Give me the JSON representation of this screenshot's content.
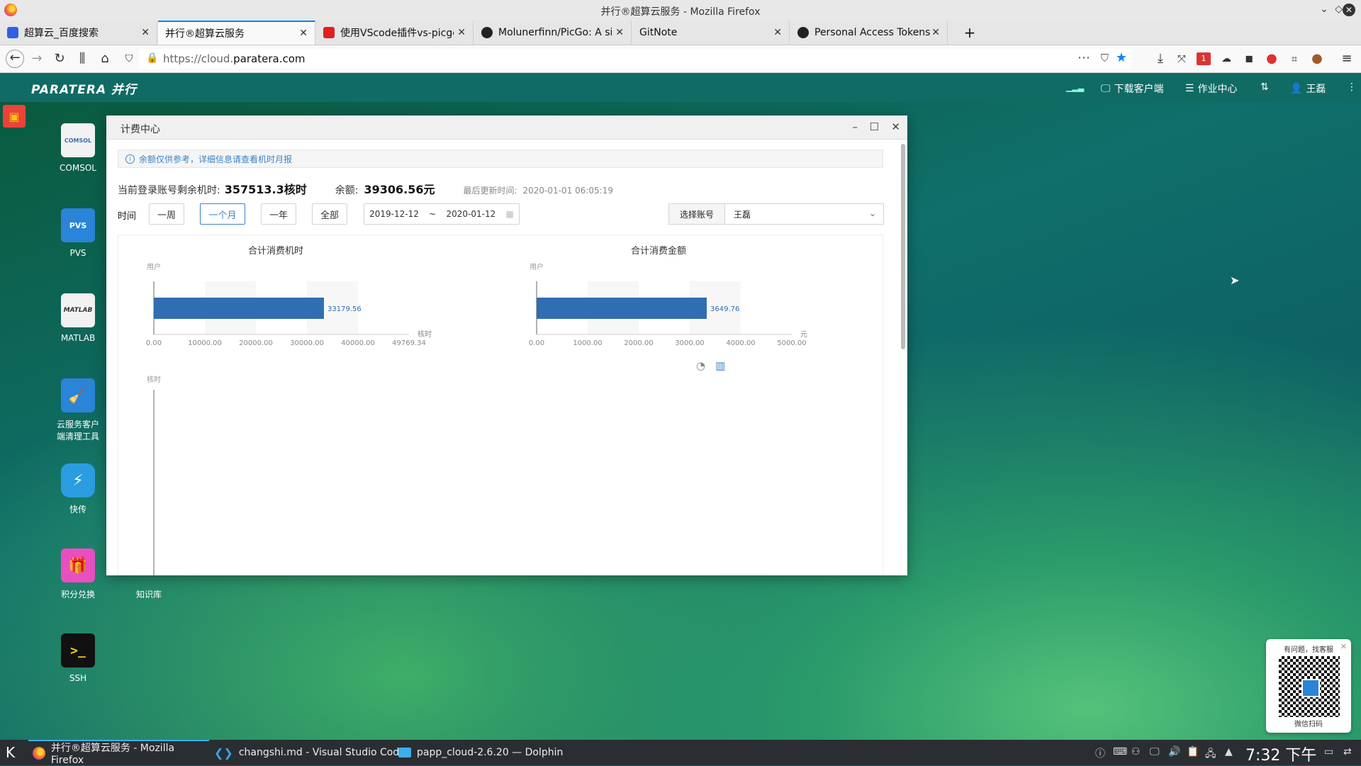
{
  "window": {
    "title": "并行®超算云服务 - Mozilla Firefox"
  },
  "tabs": [
    {
      "label": "超算云_百度搜索",
      "favicon_color": "#3060e0"
    },
    {
      "label": "并行®超算云服务",
      "favicon_color": "#ffffff"
    },
    {
      "label": "使用VScode插件vs-picgo作",
      "favicon_color": "#e02020"
    },
    {
      "label": "Molunerfinn/PicGo: A simp",
      "favicon_color": "#222222"
    },
    {
      "label": "GitNote",
      "favicon_color": "#ffffff"
    },
    {
      "label": "Personal Access Tokens",
      "favicon_color": "#222222"
    }
  ],
  "new_tab": "+",
  "nav": {
    "url_prefix": "https://cloud.",
    "url_domain": "paratera.com",
    "badge": "1"
  },
  "app_header": {
    "logo": "PARATERA 并行",
    "download": "下载客户端",
    "jobs": "作业中心",
    "user": "王磊"
  },
  "desktop_icons": [
    {
      "label": "COMSOL",
      "glyph": "COMSOL",
      "color": "#f2f2f2"
    },
    {
      "label": "PVS",
      "glyph": "PVS",
      "color": "#2a84d8"
    },
    {
      "label": "MATLAB",
      "glyph": "MATLAB",
      "color": "#f2f2f2"
    },
    {
      "label": "云服务客户端清理工具",
      "glyph": "🧹",
      "color": "#2a84d8"
    },
    {
      "label": "快传",
      "glyph": "⚡",
      "color": "#2a9de0"
    },
    {
      "label": "积分兑换",
      "glyph": "🎁",
      "color": "#e84fc0"
    },
    {
      "label": "SSH",
      "glyph": ">_",
      "color": "#111111"
    },
    {
      "label": "知识库",
      "glyph": "",
      "color": "#1e5f9e"
    }
  ],
  "dialog": {
    "title": "计费中心",
    "notice": "余额仅供参考，详细信息请查看机时月报",
    "remaining_label": "当前登录账号剩余机时:",
    "remaining_value": "357513.3核时",
    "balance_label": "余额:",
    "balance_value": "39306.56元",
    "updated_label": "最后更新时间:",
    "updated_value": "2020-01-01 06:05:19",
    "time_label": "时间",
    "ranges": [
      "一周",
      "一个月",
      "一年",
      "全部"
    ],
    "active_range": "一个月",
    "date_from": "2019-12-12",
    "date_sep": "~",
    "date_to": "2020-01-12",
    "account_label": "选择账号",
    "account_value": "王磊"
  },
  "chart_data": [
    {
      "type": "bar",
      "orientation": "horizontal",
      "title": "合计消费机时",
      "ylabel": "用户",
      "xlabel": "核时",
      "categories": [
        ""
      ],
      "values": [
        33179.56
      ],
      "value_label": "33179.56",
      "xticks": [
        "0.00",
        "10000.00",
        "20000.00",
        "30000.00",
        "40000.00",
        "49769.34"
      ],
      "xlim": [
        0,
        49769.34
      ],
      "color": "#2f6eb0"
    },
    {
      "type": "bar",
      "orientation": "horizontal",
      "title": "合计消费金额",
      "ylabel": "用户",
      "xlabel": "元",
      "categories": [
        ""
      ],
      "values": [
        3649.76
      ],
      "value_label": "3649.76",
      "xticks": [
        "0.00",
        "1000.00",
        "2000.00",
        "3000.00",
        "4000.00",
        "5000.00"
      ],
      "xlim": [
        0,
        5474.64
      ],
      "color": "#2f6eb0"
    },
    {
      "type": "line",
      "ylabel": "核时",
      "series": []
    }
  ],
  "qr_popup": {
    "title": "有问题，找客服",
    "caption": "微信扫码"
  },
  "taskbar": {
    "tasks": [
      {
        "label": "并行®超算云服务 - Mozilla Firefox"
      },
      {
        "label": "changshi.md - Visual Studio Code"
      },
      {
        "label": "papp_cloud-2.6.20 — Dolphin"
      }
    ],
    "clock": "7:32 下午"
  }
}
